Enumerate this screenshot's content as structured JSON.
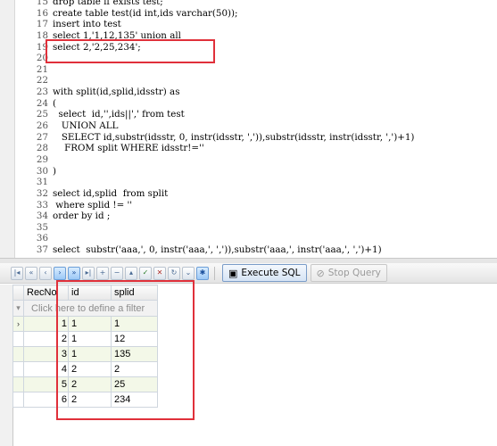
{
  "editor": {
    "lines": [
      {
        "n": "15",
        "text": "drop table if exists test;"
      },
      {
        "n": "16",
        "text": "create table test(id int,ids varchar(50));"
      },
      {
        "n": "17",
        "text": "insert into test"
      },
      {
        "n": "18",
        "text": "select 1,'1,12,135' union all"
      },
      {
        "n": "19",
        "text": "select 2,'2,25,234';"
      },
      {
        "n": "20",
        "text": ""
      },
      {
        "n": "21",
        "text": ""
      },
      {
        "n": "22",
        "text": ""
      },
      {
        "n": "23",
        "text": "with split(id,splid,idsstr) as"
      },
      {
        "n": "24",
        "text": "("
      },
      {
        "n": "25",
        "text": "  select  id,'',ids||',' from test"
      },
      {
        "n": "26",
        "text": "   UNION ALL"
      },
      {
        "n": "27",
        "text": "   SELECT id,substr(idsstr, 0, instr(idsstr, ',')),substr(idsstr, instr(idsstr, ',')+1)"
      },
      {
        "n": "28",
        "text": "    FROM split WHERE idsstr!=''"
      },
      {
        "n": "29",
        "text": ""
      },
      {
        "n": "30",
        "text": ")"
      },
      {
        "n": "31",
        "text": ""
      },
      {
        "n": "32",
        "text": "select id,splid  from split"
      },
      {
        "n": "33",
        "text": " where splid != ''"
      },
      {
        "n": "34",
        "text": "order by id ;"
      },
      {
        "n": "35",
        "text": ""
      },
      {
        "n": "36",
        "text": ""
      },
      {
        "n": "37",
        "text": "select  substr('aaa,', 0, instr('aaa,', ',')),substr('aaa,', instr('aaa,', ',')+1)"
      }
    ]
  },
  "toolbar": {
    "execute_label": "Execute SQL",
    "stop_label": "Stop Query",
    "nav_icons": [
      "first-icon",
      "prev-page-icon",
      "prev-icon",
      "next-icon",
      "next-page-icon",
      "last-icon",
      "insert-icon",
      "delete-icon",
      "edit-icon",
      "up-icon",
      "cancel-icon",
      "refresh-icon",
      "bookmark-icon",
      "goto-icon"
    ]
  },
  "grid": {
    "columns": [
      "RecNo",
      "id",
      "splid"
    ],
    "filter_hint": "Click here to define a filter",
    "rows": [
      {
        "recno": "1",
        "id": "1",
        "splid": "1"
      },
      {
        "recno": "2",
        "id": "1",
        "splid": "12"
      },
      {
        "recno": "3",
        "id": "1",
        "splid": "135"
      },
      {
        "recno": "4",
        "id": "2",
        "splid": "2"
      },
      {
        "recno": "5",
        "id": "2",
        "splid": "25"
      },
      {
        "recno": "6",
        "id": "2",
        "splid": "234"
      }
    ]
  },
  "colors": {
    "highlight": "#e0303a",
    "alt_row": "#f3f8e8"
  }
}
